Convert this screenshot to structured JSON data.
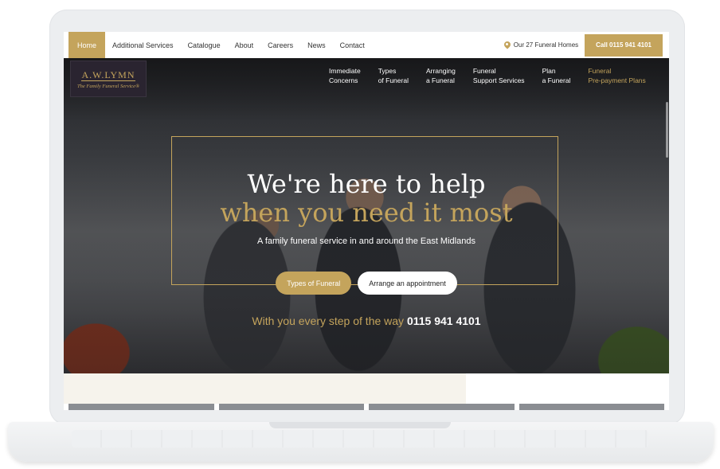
{
  "topbar": {
    "nav": [
      "Home",
      "Additional Services",
      "Catalogue",
      "About",
      "Careers",
      "News",
      "Contact"
    ],
    "active_index": 0,
    "homes_label": "Our 27 Funeral Homes",
    "call_label": "Call 0115 941 4101"
  },
  "logo": {
    "mark": "A.W.LYMN",
    "tagline": "The Family Funeral Service®"
  },
  "main_nav": [
    {
      "label": "Immediate\nConcerns",
      "highlight": false
    },
    {
      "label": "Types\nof Funeral",
      "highlight": false
    },
    {
      "label": "Arranging\na Funeral",
      "highlight": false
    },
    {
      "label": "Funeral\nSupport Services",
      "highlight": false
    },
    {
      "label": "Plan\na Funeral",
      "highlight": false
    },
    {
      "label": "Funeral\nPre-payment Plans",
      "highlight": true
    }
  ],
  "hero": {
    "title_line1": "We're here to help",
    "title_line2": "when you need it most",
    "subtitle": "A family funeral service in and around the East Midlands",
    "primary_button": "Types of Funeral",
    "secondary_button": "Arrange an appointment",
    "step_text": "With you every step of the way",
    "phone": "0115 941 4101"
  },
  "colors": {
    "accent": "#c4a45c",
    "dark": "#2a2c30"
  },
  "icons": {
    "location": "map-pin-icon"
  }
}
